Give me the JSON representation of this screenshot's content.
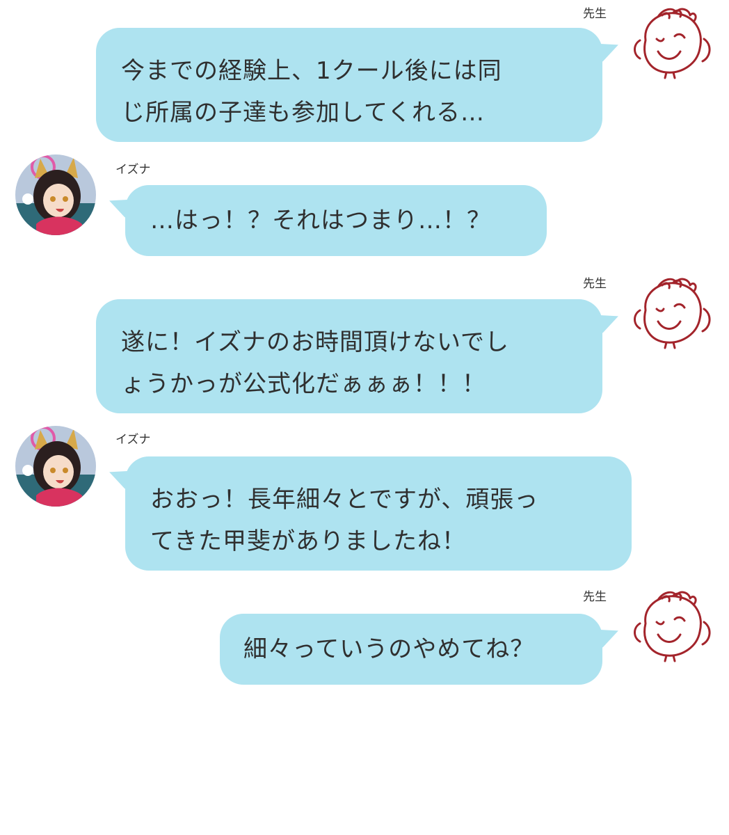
{
  "speakers": {
    "sensei": "先生",
    "izuna": "イズナ"
  },
  "messages": [
    {
      "speaker": "先生",
      "side": "right",
      "lines": [
        "今までの経験上、1クール後には同",
        "じ所属の子達も参加してくれる…"
      ]
    },
    {
      "speaker": "イズナ",
      "side": "left",
      "lines": [
        "…はっ！？それはつまり…！？"
      ]
    },
    {
      "speaker": "先生",
      "side": "right",
      "lines": [
        "遂に！イズナのお時間頂けないでし",
        "ょうかっが公式化だぁぁぁ！！！"
      ]
    },
    {
      "speaker": "イズナ",
      "side": "left",
      "lines": [
        "おおっ！長年細々とですが、頑張っ",
        "てきた甲斐がありましたね！"
      ]
    },
    {
      "speaker": "先生",
      "side": "right",
      "lines": [
        "細々っていうのやめてね？"
      ]
    }
  ],
  "icons": {
    "sensei_avatar": "doodle-face-avatar",
    "izuna_avatar": "fox-girl-avatar"
  },
  "colors": {
    "bubble": "#aee3f0",
    "text": "#2f2f2f",
    "doodle_stroke": "#a3242b"
  }
}
